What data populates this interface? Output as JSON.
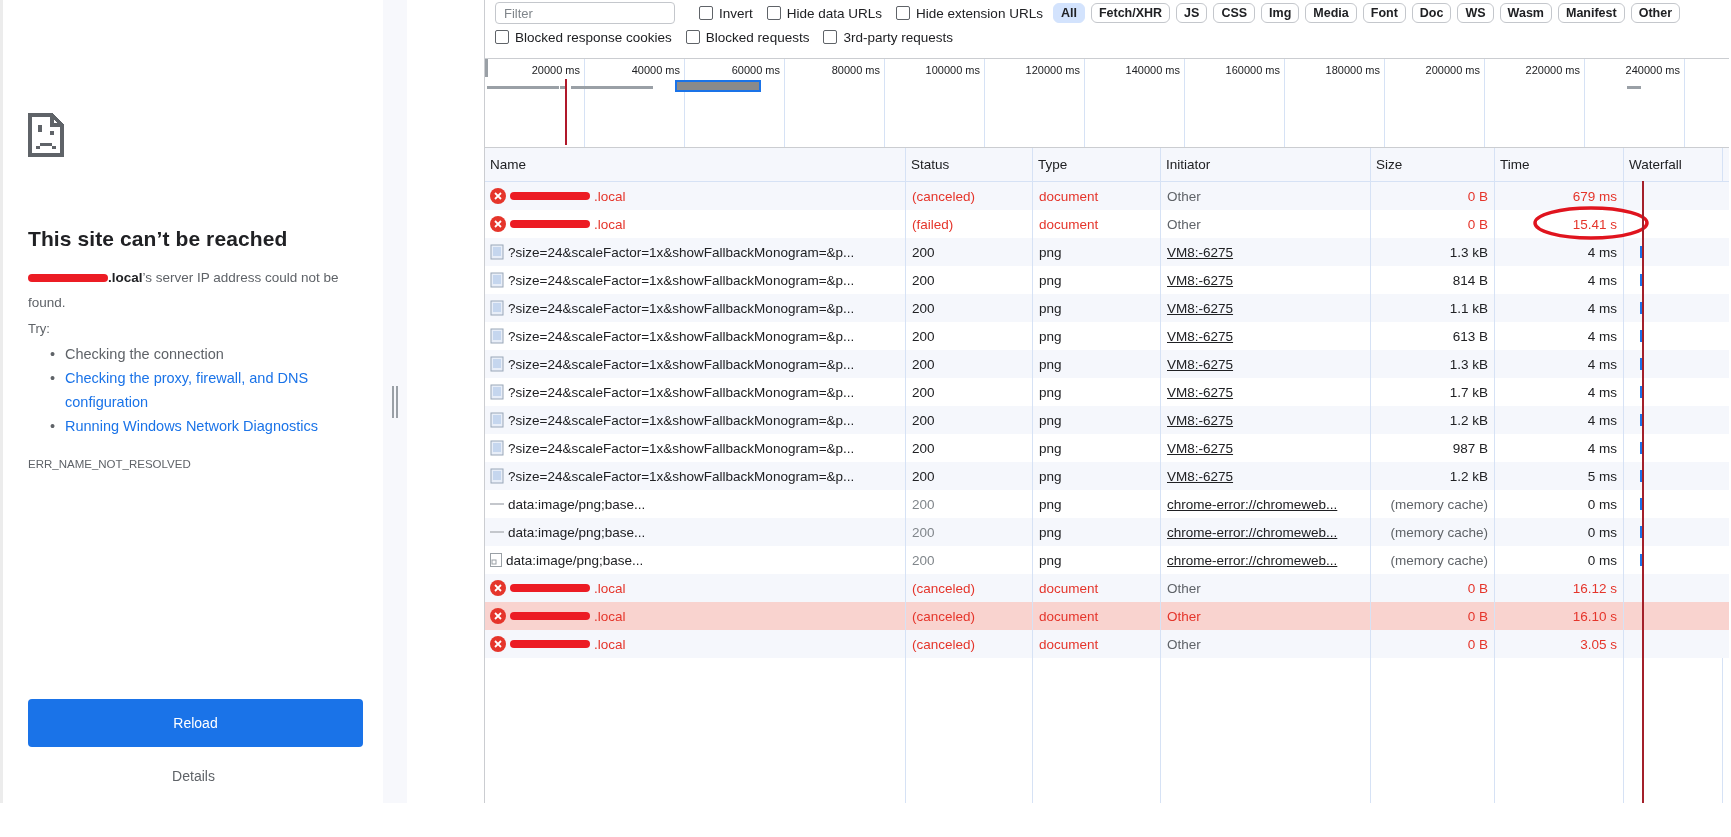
{
  "error_page": {
    "title": "This site can’t be reached",
    "message": "**.local**’s server IP address could not be found.",
    "try_label": "Try:",
    "suggestions": [
      {
        "marker": "•",
        "text": "Checking the connection",
        "link": false
      },
      {
        "marker": "•",
        "text": "Checking the proxy, firewall, and DNS configuration",
        "link": true
      },
      {
        "marker": "•",
        "text": "Running Windows Network Diagnostics",
        "link": true
      }
    ],
    "error_code": "ERR_NAME_NOT_RESOLVED",
    "reload_button": "Reload",
    "details_button": "Details"
  },
  "network_panel": {
    "filter": {
      "placeholder": "Filter"
    },
    "filter_options": [
      {
        "label": "Invert",
        "checked": false
      },
      {
        "label": "Hide data URLs",
        "checked": false
      },
      {
        "label": "Hide extension URLs",
        "checked": false
      }
    ],
    "type_filters": [
      {
        "label": "All",
        "selected": true
      },
      {
        "label": "Fetch/XHR",
        "selected": false
      },
      {
        "label": "JS",
        "selected": false
      },
      {
        "label": "CSS",
        "selected": false
      },
      {
        "label": "Img",
        "selected": false
      },
      {
        "label": "Media",
        "selected": false
      },
      {
        "label": "Font",
        "selected": false
      },
      {
        "label": "Doc",
        "selected": false
      },
      {
        "label": "WS",
        "selected": false
      },
      {
        "label": "Wasm",
        "selected": false
      },
      {
        "label": "Manifest",
        "selected": false
      },
      {
        "label": "Other",
        "selected": false
      }
    ],
    "extra_options": [
      {
        "label": "Blocked response cookies",
        "checked": false
      },
      {
        "label": "Blocked requests",
        "checked": false
      },
      {
        "label": "3rd-party requests",
        "checked": false
      }
    ],
    "overview_ticks": [
      "20000 ms",
      "40000 ms",
      "60000 ms",
      "80000 ms",
      "100000 ms",
      "120000 ms",
      "140000 ms",
      "160000 ms",
      "180000 ms",
      "200000 ms",
      "220000 ms",
      "240000 ms"
    ],
    "columns": [
      "Name",
      "Status",
      "Type",
      "Initiator",
      "Size",
      "Time",
      "Waterfall"
    ],
    "rows": [
      {
        "kind": "error",
        "name": ".local",
        "status": "(canceled)",
        "type": "document",
        "initiator": "Other",
        "initiator_link": false,
        "size": "0 B",
        "time": "679 ms",
        "selected": false,
        "circled": false
      },
      {
        "kind": "error",
        "name": ".local",
        "status": "(failed)",
        "type": "document",
        "initiator": "Other",
        "initiator_link": false,
        "size": "0 B",
        "time": "15.41 s",
        "selected": false,
        "circled": true
      },
      {
        "kind": "image",
        "name": "?size=24&scaleFactor=1x&showFallbackMonogram=&p...",
        "status": "200",
        "type": "png",
        "initiator": "VM8:-6275",
        "initiator_link": true,
        "size": "1.3 kB",
        "time": "4 ms",
        "selected": false,
        "circled": false
      },
      {
        "kind": "image",
        "name": "?size=24&scaleFactor=1x&showFallbackMonogram=&p...",
        "status": "200",
        "type": "png",
        "initiator": "VM8:-6275",
        "initiator_link": true,
        "size": "814 B",
        "time": "4 ms",
        "selected": false,
        "circled": false
      },
      {
        "kind": "image",
        "name": "?size=24&scaleFactor=1x&showFallbackMonogram=&p...",
        "status": "200",
        "type": "png",
        "initiator": "VM8:-6275",
        "initiator_link": true,
        "size": "1.1 kB",
        "time": "4 ms",
        "selected": false,
        "circled": false
      },
      {
        "kind": "image",
        "name": "?size=24&scaleFactor=1x&showFallbackMonogram=&p...",
        "status": "200",
        "type": "png",
        "initiator": "VM8:-6275",
        "initiator_link": true,
        "size": "613 B",
        "time": "4 ms",
        "selected": false,
        "circled": false
      },
      {
        "kind": "image",
        "name": "?size=24&scaleFactor=1x&showFallbackMonogram=&p...",
        "status": "200",
        "type": "png",
        "initiator": "VM8:-6275",
        "initiator_link": true,
        "size": "1.3 kB",
        "time": "4 ms",
        "selected": false,
        "circled": false
      },
      {
        "kind": "image",
        "name": "?size=24&scaleFactor=1x&showFallbackMonogram=&p...",
        "status": "200",
        "type": "png",
        "initiator": "VM8:-6275",
        "initiator_link": true,
        "size": "1.7 kB",
        "time": "4 ms",
        "selected": false,
        "circled": false
      },
      {
        "kind": "image",
        "name": "?size=24&scaleFactor=1x&showFallbackMonogram=&p...",
        "status": "200",
        "type": "png",
        "initiator": "VM8:-6275",
        "initiator_link": true,
        "size": "1.2 kB",
        "time": "4 ms",
        "selected": false,
        "circled": false
      },
      {
        "kind": "image",
        "name": "?size=24&scaleFactor=1x&showFallbackMonogram=&p...",
        "status": "200",
        "type": "png",
        "initiator": "VM8:-6275",
        "initiator_link": true,
        "size": "987 B",
        "time": "4 ms",
        "selected": false,
        "circled": false
      },
      {
        "kind": "image",
        "name": "?size=24&scaleFactor=1x&showFallbackMonogram=&p...",
        "status": "200",
        "type": "png",
        "initiator": "VM8:-6275",
        "initiator_link": true,
        "size": "1.2 kB",
        "time": "5 ms",
        "selected": false,
        "circled": false
      },
      {
        "kind": "data",
        "name": "data:image/png;base...",
        "status": "200",
        "type": "png",
        "initiator": "chrome-error://chromeweb...",
        "initiator_link": true,
        "size": "(memory cache)",
        "time": "0 ms",
        "selected": false,
        "circled": false
      },
      {
        "kind": "data",
        "name": "data:image/png;base...",
        "status": "200",
        "type": "png",
        "initiator": "chrome-error://chromeweb...",
        "initiator_link": true,
        "size": "(memory cache)",
        "time": "0 ms",
        "selected": false,
        "circled": false
      },
      {
        "kind": "datafile",
        "name": "data:image/png;base...",
        "status": "200",
        "type": "png",
        "initiator": "chrome-error://chromeweb...",
        "initiator_link": true,
        "size": "(memory cache)",
        "time": "0 ms",
        "selected": false,
        "circled": false
      },
      {
        "kind": "error",
        "name": ".local",
        "status": "(canceled)",
        "type": "document",
        "initiator": "Other",
        "initiator_link": false,
        "size": "0 B",
        "time": "16.12 s",
        "selected": false,
        "circled": false
      },
      {
        "kind": "error",
        "name": ".local",
        "status": "(canceled)",
        "type": "document",
        "initiator": "Other",
        "initiator_link": false,
        "size": "0 B",
        "time": "16.10 s",
        "selected": true,
        "circled": false
      },
      {
        "kind": "error",
        "name": ".local",
        "status": "(canceled)",
        "type": "document",
        "initiator": "Other",
        "initiator_link": false,
        "size": "0 B",
        "time": "3.05 s",
        "selected": false,
        "circled": false
      }
    ]
  }
}
